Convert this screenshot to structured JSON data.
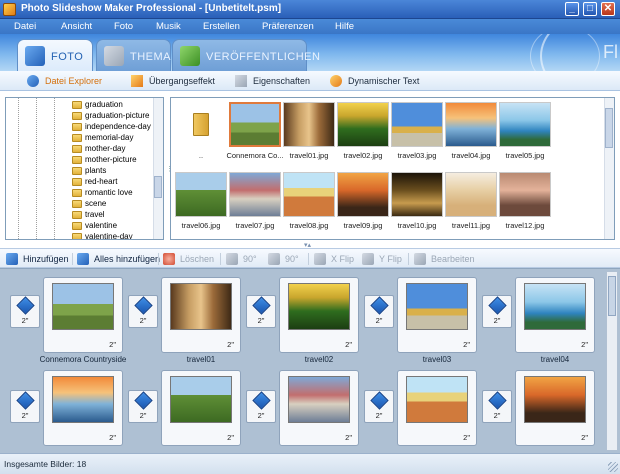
{
  "window": {
    "title": "Photo Slideshow Maker Professional - [Unbetitelt.psm]",
    "minimize": "_",
    "maximize": "□",
    "close": "✕"
  },
  "menu": [
    "Datei",
    "Ansicht",
    "Foto",
    "Musik",
    "Erstellen",
    "Präferenzen",
    "Hilfe"
  ],
  "main_tabs": [
    {
      "label": "FOTO",
      "icon": "photo-icon",
      "active": true
    },
    {
      "label": "THEMA",
      "icon": "theme-icon",
      "active": false
    },
    {
      "label": "VERÖFFENTLICHEN",
      "icon": "publish-icon",
      "active": false
    }
  ],
  "brand_fragment": "Fl",
  "sub_tabs": [
    {
      "label": "Datei Explorer",
      "icon": "magnifier-icon",
      "active": true
    },
    {
      "label": "Übergangseffekt",
      "icon": "sparkle-icon",
      "active": false
    },
    {
      "label": "Eigenschaften",
      "icon": "properties-icon",
      "active": false
    },
    {
      "label": "Dynamischer Text",
      "icon": "text-icon",
      "active": false
    }
  ],
  "folder_tree": [
    "graduation",
    "graduation-picture",
    "independence-day",
    "memorial-day",
    "mother-day",
    "mother-picture",
    "plants",
    "red-heart",
    "romantic love",
    "scene",
    "travel",
    "valentine",
    "valentine-day"
  ],
  "files": [
    {
      "name": "..",
      "kind": "folder"
    },
    {
      "name": "Connemora Co...",
      "kind": "image",
      "scene": "connemara",
      "selected": true
    },
    {
      "name": "travel01.jpg",
      "kind": "image",
      "scene": "travel01"
    },
    {
      "name": "travel02.jpg",
      "kind": "image",
      "scene": "travel02"
    },
    {
      "name": "travel03.jpg",
      "kind": "image",
      "scene": "travel03"
    },
    {
      "name": "travel04.jpg",
      "kind": "image",
      "scene": "travel04"
    },
    {
      "name": "travel05.jpg",
      "kind": "image",
      "scene": "travel05"
    },
    {
      "name": "travel06.jpg",
      "kind": "image",
      "scene": "travel06"
    },
    {
      "name": "travel07.jpg",
      "kind": "image",
      "scene": "travel07"
    },
    {
      "name": "travel08.jpg",
      "kind": "image",
      "scene": "travel08"
    },
    {
      "name": "travel09.jpg",
      "kind": "image",
      "scene": "travel09"
    },
    {
      "name": "travel10.jpg",
      "kind": "image",
      "scene": "travel10"
    },
    {
      "name": "travel11.jpg",
      "kind": "image",
      "scene": "travel11"
    },
    {
      "name": "travel12.jpg",
      "kind": "image",
      "scene": "travel12"
    }
  ],
  "toolbar": [
    {
      "label": "Hinzufügen",
      "icon": "add-icon",
      "enabled": true
    },
    {
      "label": "Alles hinzufügen",
      "icon": "add-all-icon",
      "enabled": true
    },
    {
      "label": "Löschen",
      "icon": "delete-icon",
      "enabled": false
    },
    {
      "label": "90°",
      "icon": "rotate-left-icon",
      "enabled": false
    },
    {
      "label": "90°",
      "icon": "rotate-right-icon",
      "enabled": false
    },
    {
      "label": "X Flip",
      "icon": "flip-x-icon",
      "enabled": false
    },
    {
      "label": "Y Flip",
      "icon": "flip-y-icon",
      "enabled": false
    },
    {
      "label": "Bearbeiten",
      "icon": "edit-icon",
      "enabled": false
    }
  ],
  "storyboard": {
    "slides": [
      {
        "label": "Connemora Countryside",
        "duration": "2\"",
        "transition": "2\"",
        "scene": "connemara"
      },
      {
        "label": "travel01",
        "duration": "2\"",
        "transition": "2\"",
        "scene": "travel01"
      },
      {
        "label": "travel02",
        "duration": "2\"",
        "transition": "2\"",
        "scene": "travel02"
      },
      {
        "label": "travel03",
        "duration": "2\"",
        "transition": "2\"",
        "scene": "travel03"
      },
      {
        "label": "travel04",
        "duration": "2\"",
        "transition": "2\"",
        "scene": "travel05"
      },
      {
        "label": "",
        "duration": "2\"",
        "transition": "2\"",
        "scene": "travel04"
      },
      {
        "label": "",
        "duration": "2\"",
        "transition": "2\"",
        "scene": "travel06"
      },
      {
        "label": "",
        "duration": "2\"",
        "transition": "2\"",
        "scene": "travel07"
      },
      {
        "label": "",
        "duration": "2\"",
        "transition": "2\"",
        "scene": "travel08"
      },
      {
        "label": "",
        "duration": "2\"",
        "transition": "2\"",
        "scene": "travel09"
      }
    ]
  },
  "status": {
    "text": "Insgesamte Bilder: 18"
  },
  "colors": {
    "titlebar": "#2a5fb8",
    "accent_orange": "#d4700c",
    "storyboard_bg": "#aec0d3"
  }
}
